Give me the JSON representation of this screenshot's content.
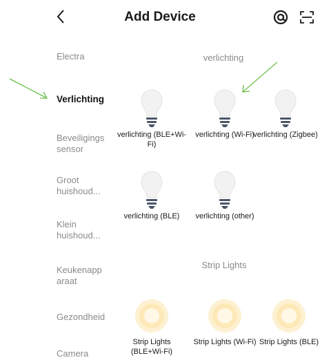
{
  "header": {
    "title": "Add Device",
    "back_icon": "chevron-left-icon",
    "at_icon": "at-sign-icon",
    "scan_icon": "scan-icon"
  },
  "sidebar": {
    "items": [
      {
        "label": "Electra",
        "active": false
      },
      {
        "label": "Verlichting",
        "active": true
      },
      {
        "label": "Beveiligings sensor",
        "active": false
      },
      {
        "label": "Groot huishoud...",
        "active": false
      },
      {
        "label": "Klein huishoud...",
        "active": false
      },
      {
        "label": "Keukenapp araat",
        "active": false
      },
      {
        "label": "Gezondheid",
        "active": false
      },
      {
        "label": "Camera",
        "active": false
      }
    ]
  },
  "main": {
    "sections": [
      {
        "title": "verlichting",
        "devices": [
          {
            "label": "verlichting (BLE+Wi-Fi)",
            "icon": "light-bulb-icon"
          },
          {
            "label": "verlichting (Wi-Fi)",
            "icon": "light-bulb-icon"
          },
          {
            "label": "verlichting (Zigbee)",
            "icon": "light-bulb-icon"
          },
          {
            "label": "verlichting (BLE)",
            "icon": "light-bulb-icon"
          },
          {
            "label": "verlichting (other)",
            "icon": "light-bulb-icon"
          }
        ]
      },
      {
        "title": "Strip Lights",
        "devices": [
          {
            "label": "Strip Lights (BLE+Wi-Fi)",
            "icon": "strip-light-icon"
          },
          {
            "label": "Strip Lights (Wi-Fi)",
            "icon": "strip-light-icon"
          },
          {
            "label": "Strip Lights (BLE)",
            "icon": "strip-light-icon"
          }
        ]
      }
    ]
  },
  "colors": {
    "annotation_arrow": "#6cc04a",
    "bulb_glass": "#f2f2f2",
    "bulb_base": "#4a5668",
    "strip_glow": "#fde9b8",
    "text_muted": "#8a8a8a"
  }
}
